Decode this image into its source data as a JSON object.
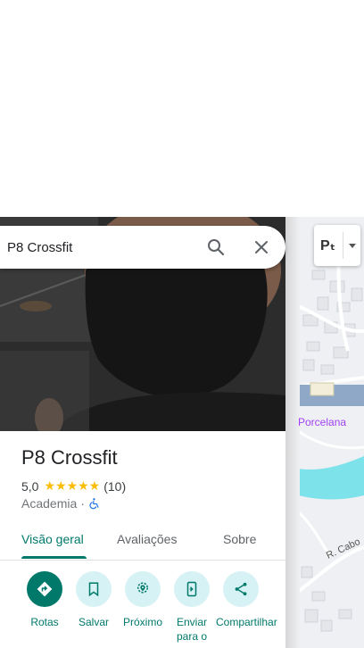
{
  "search": {
    "value": "P8 Crossfit"
  },
  "place": {
    "name": "P8 Crossfit",
    "rating": "5,0",
    "stars": "★★★★★",
    "review_count": "(10)",
    "category": "Academia",
    "separator": "·"
  },
  "tabs": [
    {
      "label": "Visão geral",
      "active": true
    },
    {
      "label": "Avaliações",
      "active": false
    },
    {
      "label": "Sobre",
      "active": false
    }
  ],
  "actions": [
    {
      "label": "Rotas",
      "icon": "directions-icon"
    },
    {
      "label": "Salvar",
      "icon": "bookmark-icon"
    },
    {
      "label": "Próximo",
      "icon": "nearby-icon"
    },
    {
      "label": "Enviar para o",
      "icon": "send-to-phone-icon"
    },
    {
      "label": "Compartilhar",
      "icon": "share-icon"
    }
  ],
  "map": {
    "layer_label": "Pₜ",
    "place_label": "Porcelana",
    "street_label": "R. Cabo"
  },
  "colors": {
    "accent": "#00796b",
    "star": "#fbbc04",
    "action_bg": "#d6f2f5",
    "map_label": "#a142f4",
    "water": "#7ee2ea"
  }
}
